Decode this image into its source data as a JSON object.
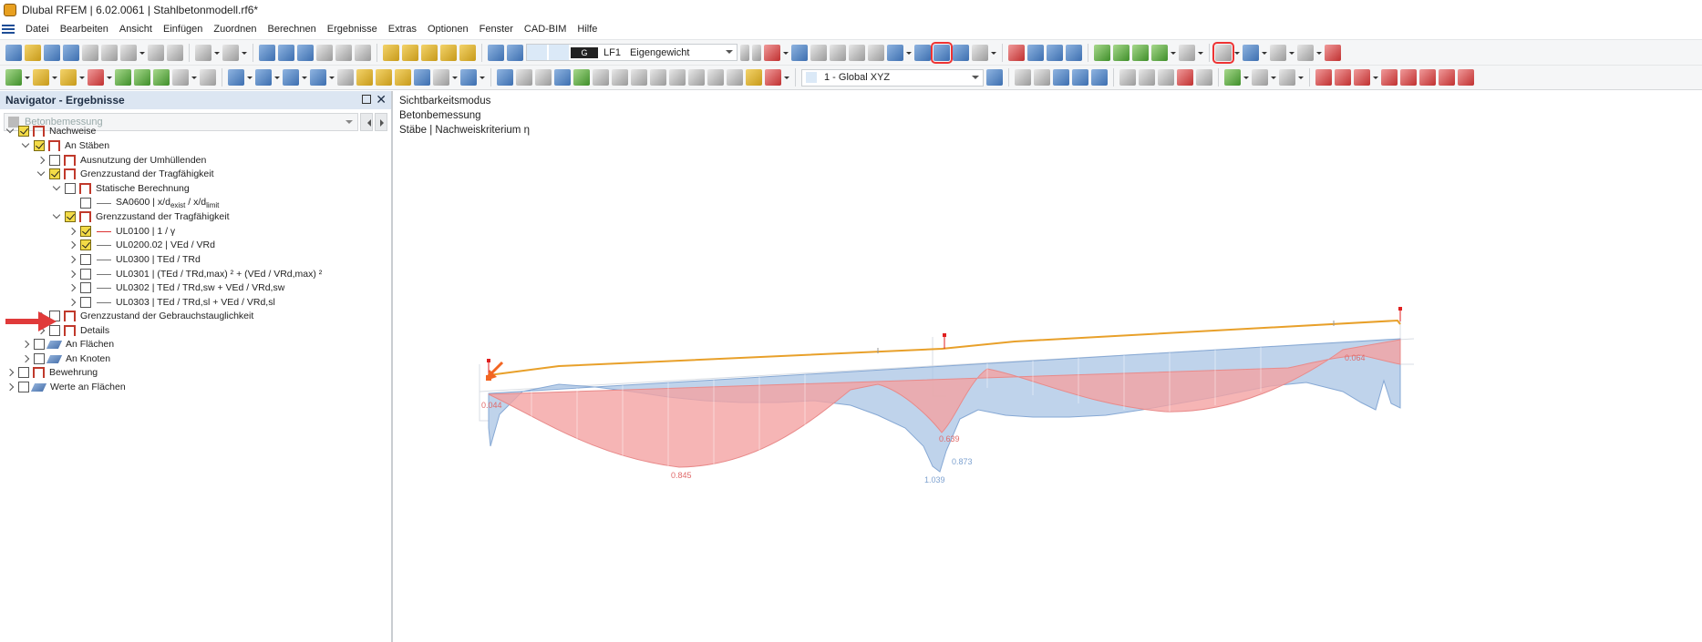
{
  "window": {
    "title": "Dlubal RFEM | 6.02.0061 | Stahlbetonmodell.rf6*"
  },
  "menu": [
    "Datei",
    "Bearbeiten",
    "Ansicht",
    "Einfügen",
    "Zuordnen",
    "Berechnen",
    "Ergebnisse",
    "Extras",
    "Optionen",
    "Fenster",
    "CAD-BIM",
    "Hilfe"
  ],
  "toolbar": {
    "loadcase_code": "G",
    "loadcase_id": "LF1",
    "loadcase_name": "Eigengewicht",
    "coord_system": "1 - Global XYZ",
    "highlighted_tools": [
      "values-display-button",
      "results-settings-button"
    ]
  },
  "navigator": {
    "title": "Navigator - Ergebnisse",
    "select_value": "Betonbemessung",
    "items": [
      {
        "label": "Nachweise",
        "checked": true,
        "expanded": true
      },
      {
        "label": "An Stäben",
        "checked": true,
        "expanded": true
      },
      {
        "label": "Ausnutzung der Umhüllenden",
        "checked": false,
        "expanded": false
      },
      {
        "label": "Grenzzustand der Tragfähigkeit",
        "checked": true,
        "expanded": true
      },
      {
        "label": "Statische Berechnung",
        "checked": false,
        "expanded": true
      },
      {
        "label": "SA0600 | x/d",
        "label_sub": "exist",
        "label_rest": " / x/d",
        "label_sub2": "limit",
        "checked": false
      },
      {
        "label": "Grenzzustand der Tragfähigkeit",
        "checked": true,
        "expanded": true
      },
      {
        "label": "UL0100 | 1 / γ",
        "checked": true,
        "expanded": false
      },
      {
        "label": "UL0200.02 | VEd / VRd",
        "checked": true,
        "expanded": false
      },
      {
        "label": "UL0300 | TEd / TRd",
        "checked": false,
        "expanded": false
      },
      {
        "label": "UL0301 | (TEd / TRd,max) ² + (VEd / VRd,max) ²",
        "checked": false,
        "expanded": false
      },
      {
        "label": "UL0302 | TEd / TRd,sw + VEd / VRd,sw",
        "checked": false,
        "expanded": false
      },
      {
        "label": "UL0303 | TEd / TRd,sl + VEd / VRd,sl",
        "checked": false,
        "expanded": false
      },
      {
        "label": "Grenzzustand der Gebrauchstauglichkeit",
        "checked": false,
        "expanded": false
      },
      {
        "label": "Details",
        "checked": false,
        "expanded": false
      },
      {
        "label": "An Flächen",
        "checked": false,
        "expanded": false
      },
      {
        "label": "An Knoten",
        "checked": false,
        "expanded": false
      },
      {
        "label": "Bewehrung",
        "checked": false,
        "expanded": false
      },
      {
        "label": "Werte an Flächen",
        "checked": false,
        "expanded": false
      }
    ]
  },
  "viewport": {
    "info_lines": [
      "Sichtbarkeitsmodus",
      "Betonbemessung",
      "Stäbe | Nachweiskriterium η"
    ],
    "value_labels": [
      "0.044",
      "0.845",
      "0.639",
      "1.039",
      "0.873",
      "0.064"
    ],
    "colors": {
      "positive": "#f4a3a3",
      "negative": "#a9c4e4",
      "beam": "#e8a02a",
      "support": "#e02020",
      "arrow": "#f26522"
    }
  }
}
